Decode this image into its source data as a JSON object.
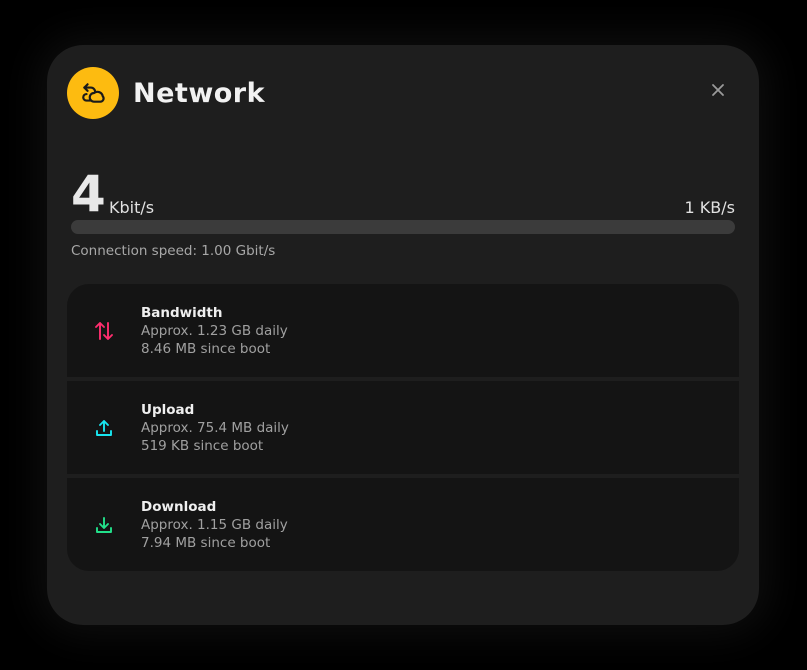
{
  "header": {
    "title": "Network",
    "icon": "network-icon",
    "accent": "#fdbb10"
  },
  "speed": {
    "value": "4",
    "unit": "Kbit/s",
    "max_label": "1 KB/s",
    "bar_fraction": 0.0,
    "connection_speed": "Connection speed: 1.00 Gbit/s"
  },
  "stats": [
    {
      "title": "Bandwidth",
      "daily": "Approx. 1.23 GB daily",
      "since_boot": "8.46 MB since boot",
      "icon": "swap-vertical-icon",
      "color": "#ff2d6e"
    },
    {
      "title": "Upload",
      "daily": "Approx. 75.4 MB daily",
      "since_boot": "519 KB since boot",
      "icon": "upload-icon",
      "color": "#18e6f0"
    },
    {
      "title": "Download",
      "daily": "Approx. 1.15 GB daily",
      "since_boot": "7.94 MB since boot",
      "icon": "download-icon",
      "color": "#22e08a"
    }
  ]
}
